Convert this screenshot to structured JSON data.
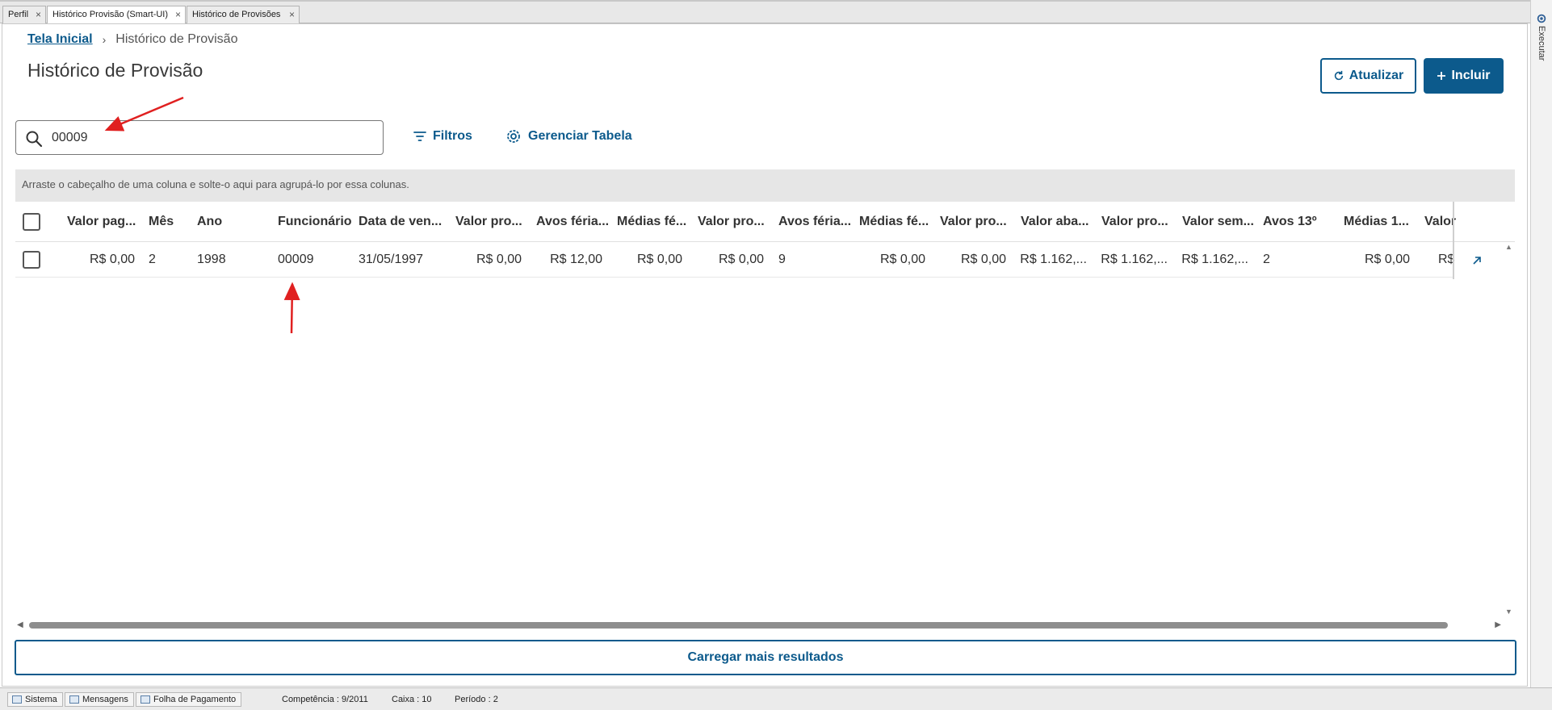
{
  "tabs": [
    {
      "label": "Perfil",
      "active": false
    },
    {
      "label": "Histórico Provisão (Smart-UI)",
      "active": true
    },
    {
      "label": "Histórico de Provisões",
      "active": false
    }
  ],
  "tab_close_glyph": "×",
  "side_panel": {
    "label": "Executar",
    "icon": "gear-icon"
  },
  "breadcrumb": {
    "home": "Tela Inicial",
    "separator": "›",
    "current": "Histórico de Provisão"
  },
  "page_title": "Histórico de Provisão",
  "actions": {
    "refresh_label": "Atualizar",
    "refresh_icon": "refresh-icon",
    "add_label": "Incluir",
    "add_icon": "plus-icon"
  },
  "search": {
    "value": "00009",
    "icon": "search-icon"
  },
  "toolbar": {
    "filters_label": "Filtros",
    "filters_icon": "filter-icon",
    "manage_label": "Gerenciar Tabela",
    "manage_icon": "gear-icon"
  },
  "group_hint": "Arraste o cabeçalho de uma coluna e solte-o aqui para agrupá-lo por essa colunas.",
  "table": {
    "columns": [
      "Valor pag...",
      "Mês",
      "Ano",
      "Funcionário",
      "Data de ven...",
      "Valor pro...",
      "Avos féria...",
      "Médias fé...",
      "Valor pro...",
      "Avos féria...",
      "Médias fé...",
      "Valor pro...",
      "Valor aba...",
      "Valor pro...",
      "Valor sem...",
      "Avos 13º",
      "Médias 1...",
      "Valor"
    ],
    "rows": [
      [
        "R$ 0,00",
        "2",
        "1998",
        "00009",
        "31/05/1997",
        "R$ 0,00",
        "R$ 12,00",
        "R$ 0,00",
        "R$ 0,00",
        "9",
        "R$ 0,00",
        "R$ 0,00",
        "R$ 1.162,...",
        "R$ 1.162,...",
        "R$ 1.162,...",
        "2",
        "R$ 0,00",
        "R$"
      ]
    ],
    "row_action_icon": "open-detail-icon"
  },
  "load_more_label": "Carregar mais resultados",
  "status_bar": {
    "tabs": [
      {
        "label": "Sistema",
        "icon": "system-icon"
      },
      {
        "label": "Mensagens",
        "icon": "messages-icon"
      },
      {
        "label": "Folha de Pagamento",
        "icon": "payroll-icon"
      }
    ],
    "competencia": "Competência : 9/2011",
    "caixa": "Caixa : 10",
    "periodo": "Período : 2"
  },
  "colors": {
    "accent": "#0c5a8c",
    "annotation": "#e02020"
  }
}
